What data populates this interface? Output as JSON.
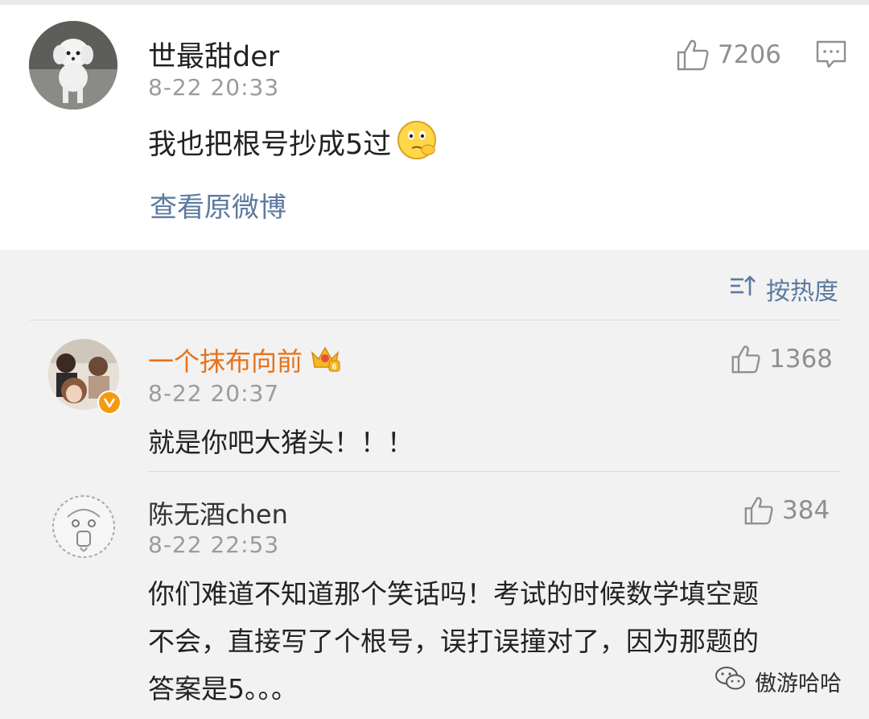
{
  "post": {
    "username": "世最甜der",
    "time": "8-22 20:33",
    "text": "我也把根号抄成5过",
    "likes": "7206",
    "view_original": "查看原微博"
  },
  "sort_label": "按热度",
  "comments": [
    {
      "username": "一个抹布向前",
      "time": "8-22 20:37",
      "text": "就是你吧大猪头！！！",
      "likes": "1368"
    },
    {
      "username": "陈无酒chen",
      "time": "8-22 22:53",
      "text_lines": [
        "你们难道不知道那个笑话吗！考试的时候数学填空题",
        "不会，直接写了个根号，误打误撞对了，因为那题的",
        "答案是5。。。"
      ],
      "likes": "384"
    }
  ],
  "watermark": "傲游哈哈",
  "colors": {
    "link_blue": "#5b7aa0",
    "vip_orange": "#e8721a",
    "muted_gray": "#9b9b9b",
    "background": "#f2f2f2"
  },
  "icons": [
    "thumbs-up-icon",
    "comment-icon",
    "sort-icon",
    "crown-badge-icon",
    "verified-badge-icon",
    "wechat-icon",
    "emoji-icon"
  ]
}
